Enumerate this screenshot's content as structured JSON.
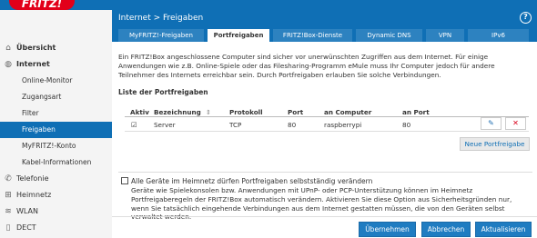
{
  "brand": {
    "logo_text": "FRITZ!"
  },
  "sidebar": {
    "items": [
      {
        "label": "Übersicht",
        "icon": "home-icon"
      },
      {
        "label": "Internet",
        "icon": "globe-icon"
      },
      {
        "label": "Online-Monitor"
      },
      {
        "label": "Zugangsart"
      },
      {
        "label": "Filter"
      },
      {
        "label": "Freigaben"
      },
      {
        "label": "MyFRITZ!-Konto"
      },
      {
        "label": "Kabel-Informationen"
      },
      {
        "label": "Telefonie",
        "icon": "phone-icon"
      },
      {
        "label": "Heimnetz",
        "icon": "network-icon"
      },
      {
        "label": "WLAN",
        "icon": "wifi-icon"
      },
      {
        "label": "DECT",
        "icon": "dect-icon"
      }
    ]
  },
  "header": {
    "breadcrumb": "Internet > Freigaben",
    "help": "?"
  },
  "tabs": [
    "MyFRITZ!-Freigaben",
    "Portfreigaben",
    "FRITZ!Box-Dienste",
    "Dynamic DNS",
    "VPN",
    "IPv6"
  ],
  "description": "Ein FRITZ!Box angeschlossene Computer sind sicher vor unerwünschten Zugriffen aus dem Internet. Für einige Anwendungen wie z.B. Online-Spiele oder das Filesharing-Programm eMule muss Ihr Computer jedoch für andere Teilnehmer des Internets erreichbar sein. Durch Portfreigaben erlauben Sie solche Verbindungen.",
  "list_title": "Liste der Portfreigaben",
  "table": {
    "headers": [
      "Aktiv",
      "Bezeichnung",
      "Protokoll",
      "Port",
      "an Computer",
      "an Port"
    ],
    "sort_icon": "sort-icon",
    "rows": [
      {
        "aktiv": "☑",
        "bezeichnung": "Server",
        "protokoll": "TCP",
        "port": "80",
        "computer": "raspberrypi",
        "an_port": "80"
      }
    ]
  },
  "buttons": {
    "new": "Neue Portfreigabe",
    "apply": "Übernehmen",
    "cancel": "Abbrechen",
    "refresh": "Aktualisieren"
  },
  "option": {
    "label": "Alle Geräte im Heimnetz dürfen Portfreigaben selbstständig verändern",
    "description": "Geräte wie Spielekonsolen bzw. Anwendungen mit UPnP- oder PCP-Unterstützung können im Heimnetz Portfreigaberegeln der FRITZ!Box automatisch verändern. Aktivieren Sie diese Option aus Sicherheitsgründen nur, wenn Sie tatsächlich eingehende Verbindungen aus dem Internet gestatten müssen, die von den Geräten selbst verwaltet werden.",
    "checked": false
  },
  "colors": {
    "accent": "#0f6fb5",
    "brand_red": "#e2001a",
    "button_blue": "#1f7cc1"
  }
}
